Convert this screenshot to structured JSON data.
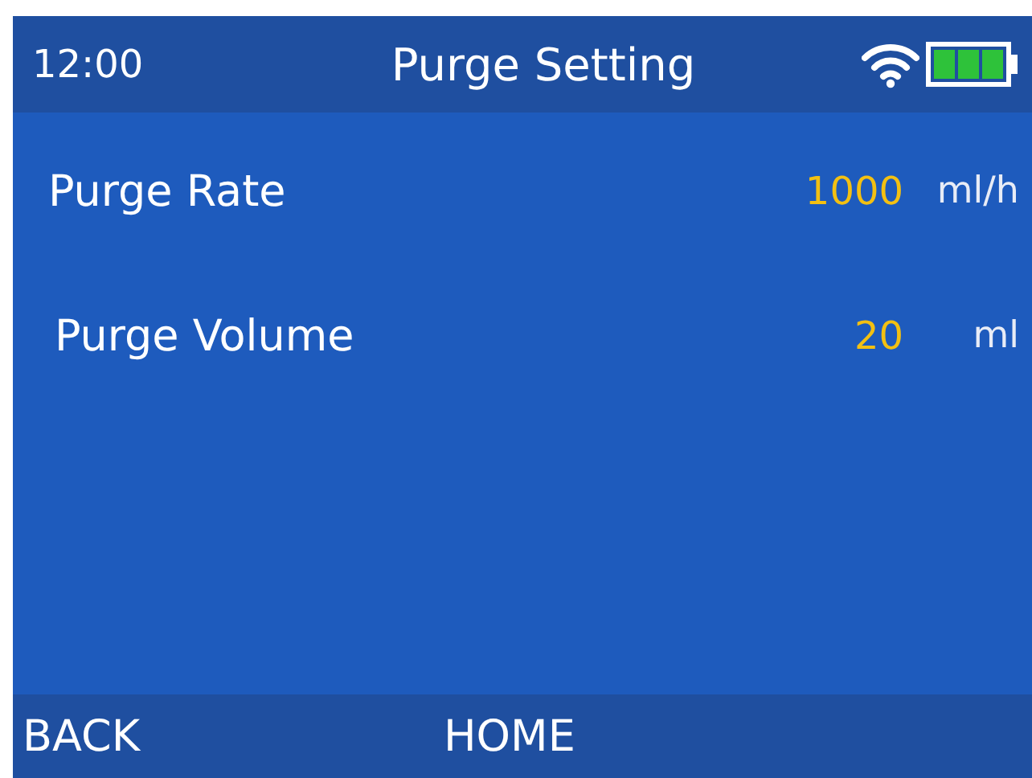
{
  "status_bar": {
    "time": "12:00",
    "title": "Purge Setting"
  },
  "settings": [
    {
      "label": "Purge Rate",
      "value": "1000",
      "unit": "ml/h"
    },
    {
      "label": "Purge Volume",
      "value": "20",
      "unit": "ml"
    }
  ],
  "soft_keys": [
    "BACK",
    "HOME"
  ]
}
